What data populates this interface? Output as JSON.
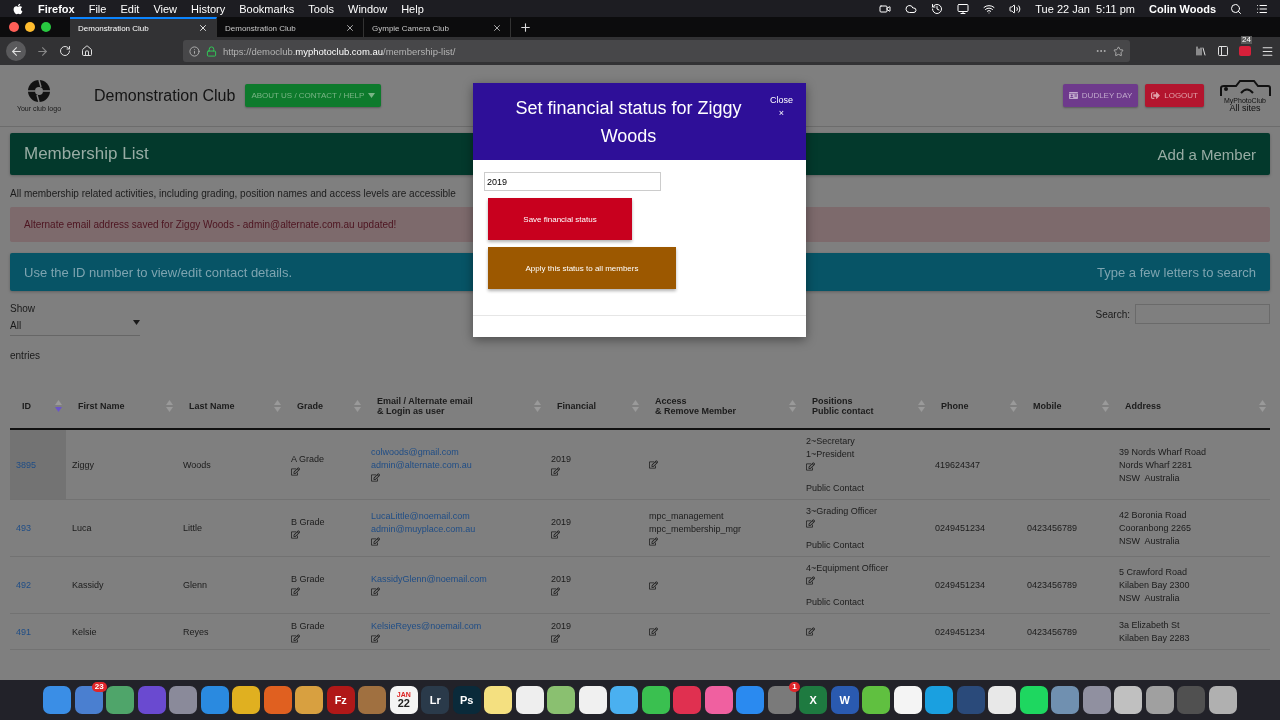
{
  "menu_bar": {
    "items": [
      {
        "label": "Firefox",
        "kind": "app"
      },
      {
        "label": "File",
        "kind": "menu"
      },
      {
        "label": "Edit",
        "kind": "menu"
      },
      {
        "label": "View",
        "kind": "menu"
      },
      {
        "label": "History",
        "kind": "menu"
      },
      {
        "label": "Bookmarks",
        "kind": "menu"
      },
      {
        "label": "Tools",
        "kind": "menu"
      },
      {
        "label": "Window",
        "kind": "menu"
      },
      {
        "label": "Help",
        "kind": "menu"
      }
    ],
    "clock": "Tue 22 Jan  5:11 pm",
    "user": "Colin Woods"
  },
  "tabs": [
    {
      "label": "Demonstration Club",
      "selected": true
    },
    {
      "label": "Demonstration Club",
      "selected": false
    },
    {
      "label": "Gympie Camera Club",
      "selected": false
    }
  ],
  "address_bar": {
    "url": "https://democlub.**myphotoclub.com.au**/membership-list/",
    "extension_badge": "24"
  },
  "header": {
    "logo_caption": "Your club logo",
    "club_name": "Demonstration Club",
    "help_button": "ABOUT US / CONTACT / HELP",
    "user_button": "DUDLEY DAY",
    "logout_button": "LOGOUT",
    "brand": "MyPhotoClub",
    "brand_link": "All sites"
  },
  "title_bar": {
    "title": "Membership List",
    "action": "Add a Member"
  },
  "description": "All membership related activities, including grading, position names and access levels are accessible",
  "alert": "Alternate email address saved for Ziggy Woods - admin@alternate.com.au updated!",
  "info_bar": {
    "left": "Use the ID number to view/edit contact details.",
    "right": "Type a few letters to search"
  },
  "length_control": {
    "label": "Show",
    "value": "All",
    "suffix": "entries"
  },
  "search": {
    "label": "Search:"
  },
  "table": {
    "columns": [
      {
        "label": "ID",
        "sorted": true
      },
      {
        "label": "First Name",
        "sorted": false
      },
      {
        "label": "Last Name",
        "sorted": false
      },
      {
        "label": "Grade",
        "sorted": false
      },
      {
        "label": "Email / Alternate email\n& Login as user",
        "sorted": false
      },
      {
        "label": "Financial",
        "sorted": false
      },
      {
        "label": "Access\n& Remove Member",
        "sorted": false
      },
      {
        "label": "Positions\nPublic contact",
        "sorted": false
      },
      {
        "label": "Phone",
        "sorted": false
      },
      {
        "label": "Mobile",
        "sorted": false
      },
      {
        "label": "Address",
        "sorted": false
      }
    ],
    "rows": [
      {
        "id": "3895",
        "first_name": "Ziggy",
        "last_name": "Woods",
        "grade": "A Grade",
        "emails": [
          "colwoods@gmail.com",
          "admin@alternate.com.au"
        ],
        "financial": "2019",
        "positions": [
          "2~Secretary",
          "1~President"
        ],
        "public_contact": "Public Contact",
        "phone": "419624347",
        "address": [
          "39 Nords Wharf Road",
          "Nords Wharf 2281",
          "NSW  Australia"
        ]
      },
      {
        "id": "493",
        "first_name": "Luca",
        "last_name": "Little",
        "grade": "B Grade",
        "emails": [
          "LucaLittle@noemail.com",
          "admin@muyplace.com.au"
        ],
        "financial": "2019",
        "access": [
          "mpc_management",
          "mpc_membership_mgr"
        ],
        "positions": [
          "3~Grading Officer"
        ],
        "public_contact": "Public Contact",
        "phone": "0249451234",
        "mobile": "0423456789",
        "address": [
          "42 Boronia Road",
          "Cooranbong 2265",
          "NSW  Australia"
        ]
      },
      {
        "id": "492",
        "first_name": "Kassidy",
        "last_name": "Glenn",
        "grade": "B Grade",
        "emails": [
          "KassidyGlenn@noemail.com"
        ],
        "financial": "2019",
        "positions": [
          "4~Equipment Officer"
        ],
        "public_contact": "Public Contact",
        "phone": "0249451234",
        "mobile": "0423456789",
        "address": [
          "5 Crawford Road",
          "Kilaben Bay 2300",
          "NSW  Australia"
        ]
      },
      {
        "id": "491",
        "first_name": "Kelsie",
        "last_name": "Reyes",
        "grade": "B Grade",
        "emails": [
          "KelsieReyes@noemail.com"
        ],
        "financial": "2019",
        "phone": "0249451234",
        "mobile": "0423456789",
        "address": [
          "3a Elizabeth St",
          "Kilaben Bay 2283"
        ]
      }
    ]
  },
  "modal": {
    "title": "Set financial status for Ziggy Woods",
    "close": "Close",
    "close_mark": "×",
    "value": "2019",
    "save_button": "Save financial status",
    "apply_button": "Apply this status to all members"
  },
  "dock": [
    {
      "color": "#3a8ee6"
    },
    {
      "color": "#4a7fd0",
      "badge": "23"
    },
    {
      "color": "#4fa56a"
    },
    {
      "color": "#6a4ad0"
    },
    {
      "color": "#8a8a9a"
    },
    {
      "color": "#2a8ae0"
    },
    {
      "color": "#e0b020"
    },
    {
      "color": "#e06020"
    },
    {
      "color": "#d8a040"
    },
    {
      "color": "#b01818",
      "label": "Fz"
    },
    {
      "color": "#a07040"
    },
    {
      "color": "#f4f4f4",
      "label": "22",
      "month": "JAN"
    },
    {
      "color": "#2a3a4a",
      "label": "Lr"
    },
    {
      "color": "#0a2a3a",
      "label": "Ps"
    },
    {
      "color": "#f4e080"
    },
    {
      "color": "#eeeeee"
    },
    {
      "color": "#8ac070"
    },
    {
      "color": "#f0f0f0"
    },
    {
      "color": "#4ab0f0"
    },
    {
      "color": "#3ac050"
    },
    {
      "color": "#e03050"
    },
    {
      "color": "#f060a0"
    },
    {
      "color": "#2a8af0"
    },
    {
      "color": "#7a7a7a",
      "badge": "1"
    },
    {
      "color": "#1e7a40",
      "label": "X"
    },
    {
      "color": "#2a5ab0",
      "label": "W"
    },
    {
      "color": "#60c040"
    },
    {
      "color": "#f4f4f4"
    },
    {
      "color": "#1aa0e0"
    },
    {
      "color": "#2a4a7a"
    },
    {
      "color": "#e8e8e8"
    },
    {
      "color": "#1ed760"
    },
    {
      "color": "#7090b0"
    },
    {
      "color": "#9090a0"
    },
    {
      "color": "#c0c0c0"
    },
    {
      "color": "#a0a0a0"
    },
    {
      "color": "#505050"
    },
    {
      "color": "#b0b0b0"
    }
  ]
}
